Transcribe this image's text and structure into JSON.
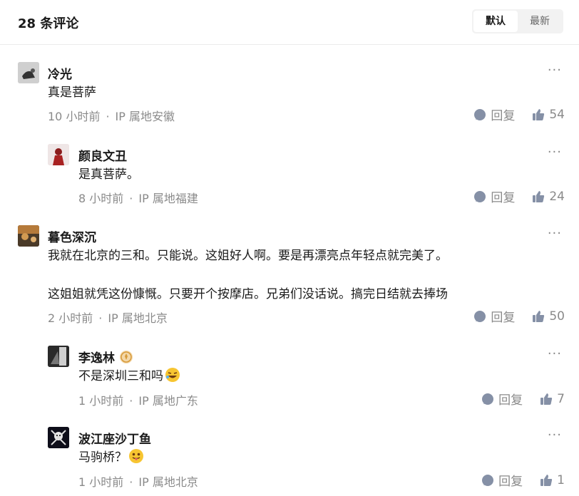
{
  "header": {
    "title": "28 条评论",
    "sort_default": "默认",
    "sort_latest": "最新"
  },
  "comments": [
    {
      "name": "冷光",
      "text": "真是菩萨",
      "time": "10 小时前",
      "location": "IP 属地安徽",
      "reply_label": "回复",
      "likes": "54"
    },
    {
      "name": "颜良文丑",
      "text": "是真菩萨。",
      "time": "8 小时前",
      "location": "IP 属地福建",
      "reply_label": "回复",
      "likes": "24"
    },
    {
      "name": "暮色深沉",
      "text_line1": "我就在北京的三和。只能说。这姐好人啊。要是再漂亮点年轻点就完美了。",
      "text_line2": "这姐姐就凭这份慷慨。只要开个按摩店。兄弟们没话说。搞完日结就去捧场",
      "time": "2 小时前",
      "location": "IP 属地北京",
      "reply_label": "回复",
      "likes": "50"
    },
    {
      "name": "李逸林",
      "text": "不是深圳三和吗",
      "time": "1 小时前",
      "location": "IP 属地广东",
      "reply_label": "回复",
      "likes": "7"
    },
    {
      "name": "波江座沙丁鱼",
      "text": "马驹桥？",
      "time": "1 小时前",
      "location": "IP 属地北京",
      "reply_label": "回复",
      "likes": "1"
    }
  ],
  "more_label": "···",
  "meta_separator": "·",
  "icons": {
    "reply": "comment-bubble-icon",
    "like": "thumbs-up-icon",
    "more": "more-dots-icon",
    "badge": "verified-badge-icon"
  },
  "colors": {
    "icon_gray": "#8590a6",
    "text_gray": "#8a8a8a"
  }
}
